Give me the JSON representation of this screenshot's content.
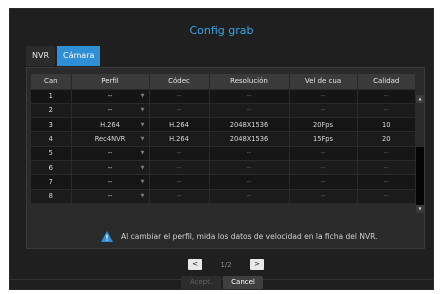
{
  "dialog": {
    "title": "Config grab"
  },
  "tabs": [
    {
      "label": "NVR"
    },
    {
      "label": "Cámara"
    }
  ],
  "table": {
    "columns": [
      "Can",
      "Perfil",
      "Códec",
      "Resolución",
      "Vel de cua",
      "Calidad"
    ],
    "rows": [
      {
        "can": "1",
        "perfil": "--",
        "codec": "--",
        "res": "--",
        "fps": "--",
        "calidad": "--"
      },
      {
        "can": "2",
        "perfil": "--",
        "codec": "--",
        "res": "--",
        "fps": "--",
        "calidad": "--"
      },
      {
        "can": "3",
        "perfil": "H.264",
        "codec": "H.264",
        "res": "2048X1536",
        "fps": "20Fps",
        "calidad": "10"
      },
      {
        "can": "4",
        "perfil": "Rec4NVR",
        "codec": "H.264",
        "res": "2048X1536",
        "fps": "15Fps",
        "calidad": "20"
      },
      {
        "can": "5",
        "perfil": "--",
        "codec": "--",
        "res": "--",
        "fps": "--",
        "calidad": "--"
      },
      {
        "can": "6",
        "perfil": "--",
        "codec": "--",
        "res": "--",
        "fps": "--",
        "calidad": "--"
      },
      {
        "can": "7",
        "perfil": "--",
        "codec": "--",
        "res": "--",
        "fps": "--",
        "calidad": "--"
      },
      {
        "can": "8",
        "perfil": "--",
        "codec": "--",
        "res": "--",
        "fps": "--",
        "calidad": "--"
      }
    ]
  },
  "notice": {
    "icon": "warning-icon",
    "color": "#2f8fd6",
    "text": "Al cambiar el perfil, mida los datos de velocidad en la ficha del NVR."
  },
  "pagination": {
    "prev": "<",
    "next": ">",
    "page": "1/2"
  },
  "footer": {
    "accept_label": "Acept.",
    "cancel_label": "Cancel"
  },
  "colors": {
    "accent": "#31a8e6",
    "active_tab": "#2f8fd6",
    "background": "#1f1f1f"
  }
}
